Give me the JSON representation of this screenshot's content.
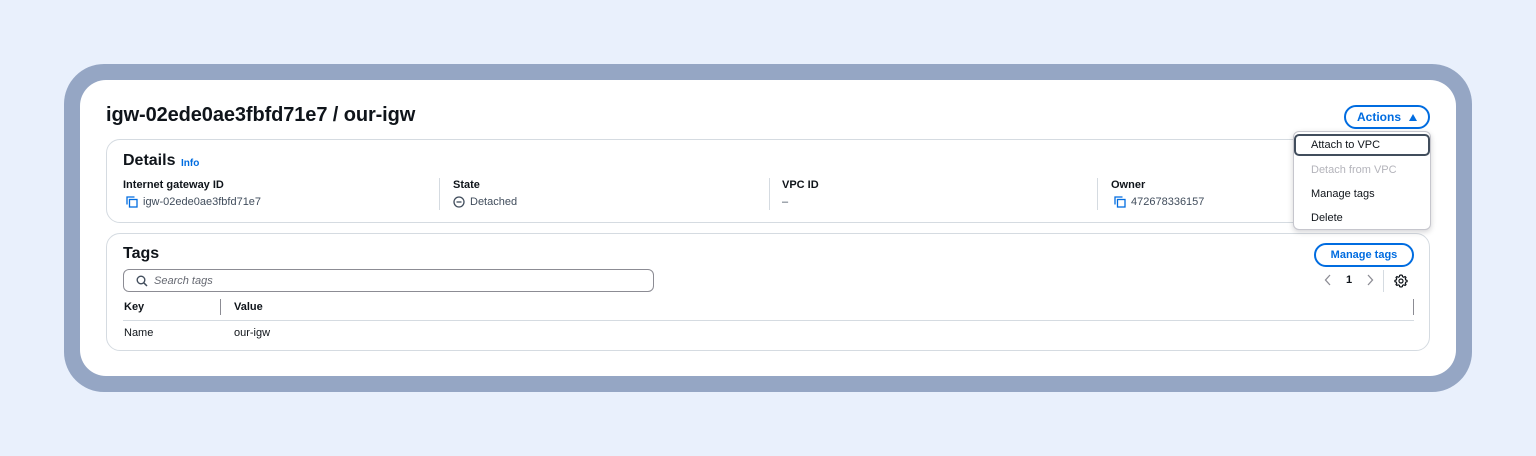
{
  "header": {
    "title": "igw-02ede0ae3fbfd71e7 / our-igw",
    "actions_label": "Actions"
  },
  "actions_menu": {
    "items": [
      {
        "label": "Attach to VPC",
        "state": "highlighted"
      },
      {
        "label": "Detach from VPC",
        "state": "disabled"
      },
      {
        "label": "Manage tags",
        "state": "enabled"
      },
      {
        "label": "Delete",
        "state": "enabled"
      }
    ]
  },
  "details": {
    "title": "Details",
    "info_label": "Info",
    "fields": [
      {
        "label": "Internet gateway ID",
        "value": "igw-02ede0ae3fbfd71e7",
        "icon": "copy-icon"
      },
      {
        "label": "State",
        "value": "Detached",
        "icon": "status-stopped-icon"
      },
      {
        "label": "VPC ID",
        "value": "–",
        "icon": ""
      },
      {
        "label": "Owner",
        "value": "472678336157",
        "icon": "copy-icon"
      }
    ]
  },
  "tags": {
    "title": "Tags",
    "manage_tags_label": "Manage tags",
    "search_placeholder": "Search tags",
    "current_page": "1",
    "columns": [
      "Key",
      "Value"
    ],
    "rows": [
      {
        "key": "Name",
        "value": "our-igw"
      }
    ]
  },
  "colors": {
    "accent": "#006ce0",
    "frame": "#95a6c4",
    "background": "#e9f0fc"
  }
}
